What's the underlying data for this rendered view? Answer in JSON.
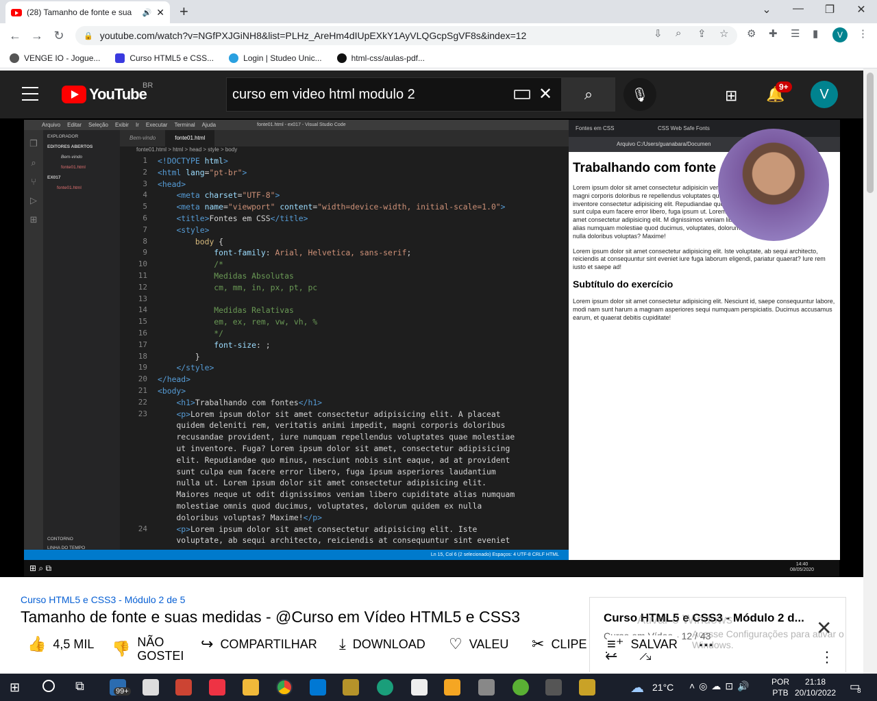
{
  "browser": {
    "tab_title": "(28) Tamanho de fonte e sua",
    "url": "youtube.com/watch?v=NGfPXJGiNH8&list=PLHz_AreHm4dIUpEXkY1AyVLQGcpSgVF8s&index=12",
    "bookmarks": [
      "VENGE IO - Jogue...",
      "Curso HTML5 e CSS...",
      "Login | Studeo Unic...",
      "html-css/aulas-pdf..."
    ],
    "profile_initial": "V"
  },
  "youtube": {
    "logo_text": "YouTube",
    "country_code": "BR",
    "search_value": "curso em video html modulo 2",
    "notifications_badge": "9+",
    "avatar_initial": "V"
  },
  "video": {
    "vscode": {
      "menu": [
        "Arquivo",
        "Editar",
        "Seleção",
        "Exibir",
        "Ir",
        "Executar",
        "Terminal",
        "Ajuda"
      ],
      "window_title": "fonte01.html - ex017 - Visual Studio Code",
      "explorer_title": "EXPLORADOR",
      "explorer_items": [
        "EDITORES ABERTOS",
        "Bem-vindo",
        "fonte01.html",
        "EX017",
        "fonte01.html"
      ],
      "outline_items": [
        "CONTORNO",
        "LINHA DO TEMPO"
      ],
      "tabs": [
        "Bem-vindo",
        "fonte01.html"
      ],
      "breadcrumb": "fonte01.html > html > head > style > body",
      "status": "Ln 15, Col 6 (2 selecionado)   Espaços: 4   UTF-8   CRLF   HTML",
      "line_numbers": [
        "1",
        "2",
        "3",
        "4",
        "5",
        "6",
        "7",
        "8",
        "9",
        "10",
        "11",
        "12",
        "13",
        "14",
        "15",
        "16",
        "17",
        "18",
        "19",
        "20",
        "21",
        "22",
        "23",
        "",
        "",
        "",
        "",
        "",
        "",
        "",
        "",
        "",
        "24",
        ""
      ]
    },
    "preview": {
      "tabs": [
        "Fontes em CSS",
        "CSS Web Safe Fonts"
      ],
      "address": "Arquivo  C:/Users/guanabara/Documen",
      "h1": "Trabalhando com fonte",
      "p1": "Lorem ipsum dolor sit amet consectetur adipisicin veritatis animi impedit, magni corporis doloribus re repellendus voluptates quae molestiae ut inventore consectetur adipisicing elit. Repudiandae quo minus provident sunt culpa eum facere error libero, fuga ipsum ut. Lorem ipsum dolor sit amet consectetur adipisicing elit. M dignissimos veniam libero cupiditate alias numquam molestiae quod ducimus, voluptates, dolorum quidem ex nulla doloribus voluptas? Maxime!",
      "p2": "Lorem ipsum dolor sit amet consectetur adipisicing elit. Iste voluptate, ab sequi architecto, reiciendis at consequuntur sint eveniet iure fuga laborum eligendi, pariatur quaerat? Iure rem iusto et saepe ad!",
      "h2": "Subtítulo do exercício",
      "p3": "Lorem ipsum dolor sit amet consectetur adipisicing elit. Nesciunt id, saepe consequuntur labore, modi nam sunt harum a magnam asperiores sequi numquam perspiciatis. Ducimus accusamus earum, et quaerat debitis cupiditate!"
    },
    "taskbar_clock": "14:40\n08/05/2020"
  },
  "page": {
    "playlist_link": "Curso HTML5 e CSS3 - Módulo 2 de 5",
    "title": "Tamanho de fonte e suas medidas - @Curso em Vídeo HTML5 e CSS3",
    "actions": {
      "like": "4,5 MIL",
      "dislike": "NÃO GOSTEI",
      "share": "COMPARTILHAR",
      "download": "DOWNLOAD",
      "thanks": "VALEU",
      "clip": "CLIPE",
      "save": "SALVAR"
    },
    "playlist_panel": {
      "name": "Curso HTML5 e CSS3 - Módulo 2 d...",
      "sub": "Curso em Vídeo - 12 / 43"
    },
    "activate_windows_1": "Ativar o Windows",
    "activate_windows_2": "Acesse Configurações para ativar o Windows."
  },
  "taskbar": {
    "mail_badge": "99+",
    "temperature": "21°C",
    "lang": "POR\nPTB",
    "time": "21:18",
    "date": "20/10/2022",
    "notif_count": "8"
  }
}
